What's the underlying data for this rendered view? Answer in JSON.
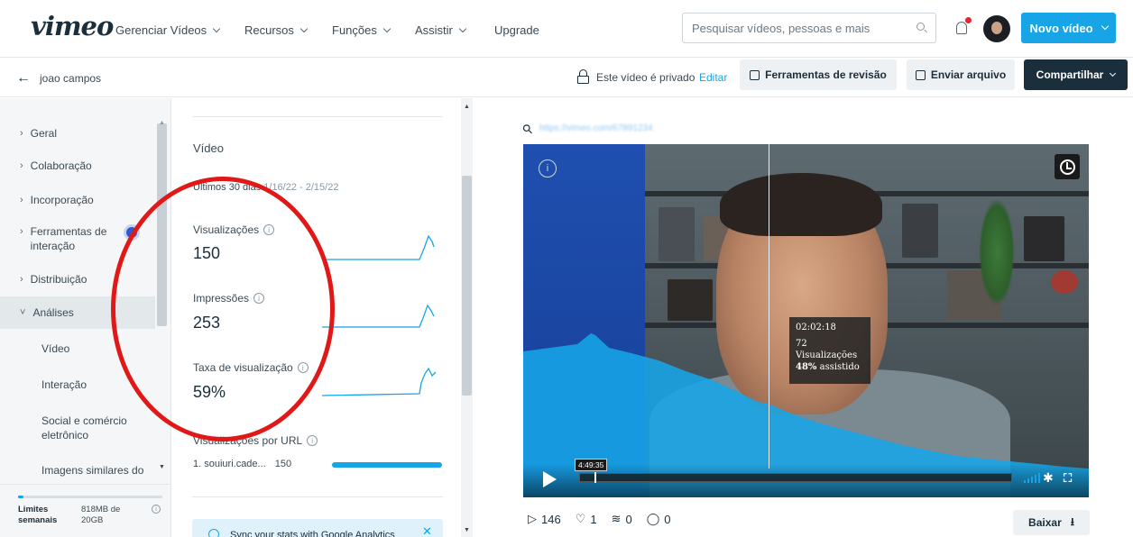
{
  "nav": {
    "logo": "vimeo",
    "links": [
      "Gerenciar Vídeos",
      "Recursos",
      "Funções",
      "Assistir",
      "Upgrade"
    ],
    "search_placeholder": "Pesquisar vídeos, pessoas e mais",
    "new_video": "Novo vídeo"
  },
  "subbar": {
    "back_label": "joao campos",
    "privacy": "Este vídeo é privado",
    "edit": "Editar",
    "review_tools": "Ferramentas de revisão",
    "send_file": "Enviar arquivo",
    "share": "Compartilhar"
  },
  "sidebar": {
    "items": [
      "Geral",
      "Colaboração",
      "Incorporação",
      "Ferramentas de interação",
      "Distribuição",
      "Análises"
    ],
    "sub_items": [
      "Vídeo",
      "Interação",
      "Social e comércio eletrônico",
      "Imagens similares do"
    ],
    "limits_label": "Limites semanais",
    "limits_value": "818MB de 20GB",
    "limits_fraction": 0.04
  },
  "stats": {
    "title": "Vídeo",
    "range_label": "Últimos 30 dias",
    "range_dates": "1/16/22 - 2/15/22",
    "metrics": [
      {
        "label": "Visualizações",
        "value": "150"
      },
      {
        "label": "Impressões",
        "value": "253"
      },
      {
        "label": "Taxa de visualização",
        "value": "59%"
      }
    ],
    "url_label": "Visualizações por URL",
    "url_row_name": "1. souiuri.cade...",
    "url_row_value": "150",
    "ga_banner": "Sync your stats with Google Analytics"
  },
  "player": {
    "tooltip_time": "02:02:18",
    "tooltip_views": "72",
    "tooltip_views_label": "Visualizações",
    "tooltip_watched": "48%",
    "tooltip_watched_label": "assistido",
    "time_badge": "4:49:35"
  },
  "video_stats": {
    "plays": "146",
    "likes": "1",
    "collections": "0",
    "comments": "0"
  },
  "download": "Baixar",
  "colors": {
    "accent": "#17a5e8",
    "dark": "#1a2e3b",
    "annotation": "#e01818"
  }
}
